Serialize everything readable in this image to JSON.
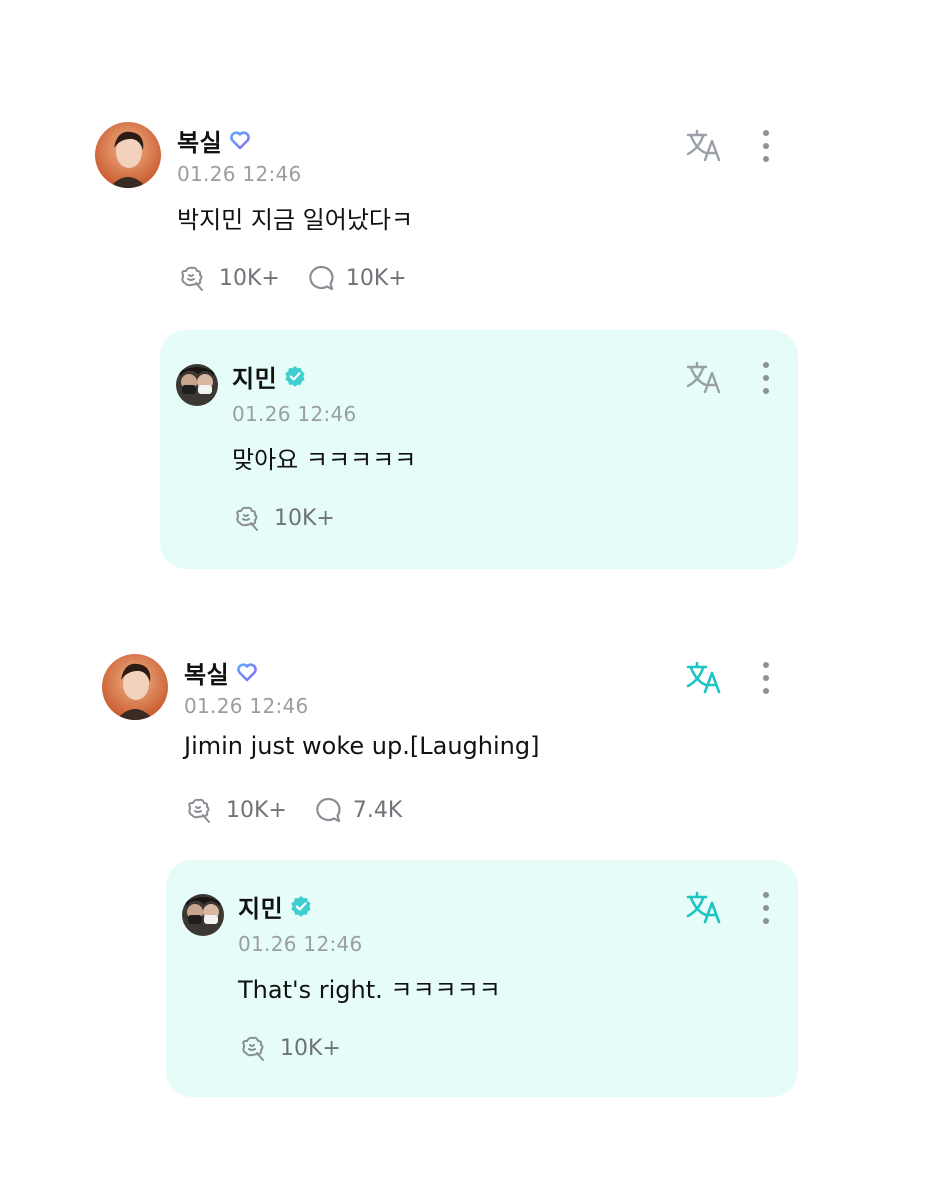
{
  "posts": [
    {
      "author": "복실",
      "time": "01.26 12:46",
      "text": "박지민 지금 일어났다ㅋ",
      "likes": "10K+",
      "comments": "10K+",
      "translate_active": false,
      "reply": {
        "author": "지민",
        "time": "01.26 12:46",
        "text": "맞아요 ㅋㅋㅋㅋㅋ",
        "likes": "10K+",
        "translate_active": false
      }
    },
    {
      "author": "복실",
      "time": "01.26 12:46",
      "text": "Jimin just woke up.[Laughing]",
      "likes": "10K+",
      "comments": "7.4K",
      "translate_active": true,
      "reply": {
        "author": "지민",
        "time": "01.26 12:46",
        "text": "That's right. ㅋㅋㅋㅋㅋ",
        "likes": "10K+",
        "translate_active": true
      }
    }
  ],
  "icons": {
    "fan_badge": "heart-badge-icon",
    "artist_badge": "verified-check-icon",
    "like": "like-icon",
    "comment": "comment-bubble-icon",
    "translate": "translate-icon",
    "more": "more-vertical-icon"
  },
  "colors": {
    "reply_background": "#e6fcf8",
    "accent_teal": "#1fc4c4",
    "translate_inactive": "#9aa0a6",
    "timestamp": "#9a9ea3",
    "fan_badge_purple": "#8b6cf5",
    "fan_badge_blue": "#5aa8ff"
  }
}
